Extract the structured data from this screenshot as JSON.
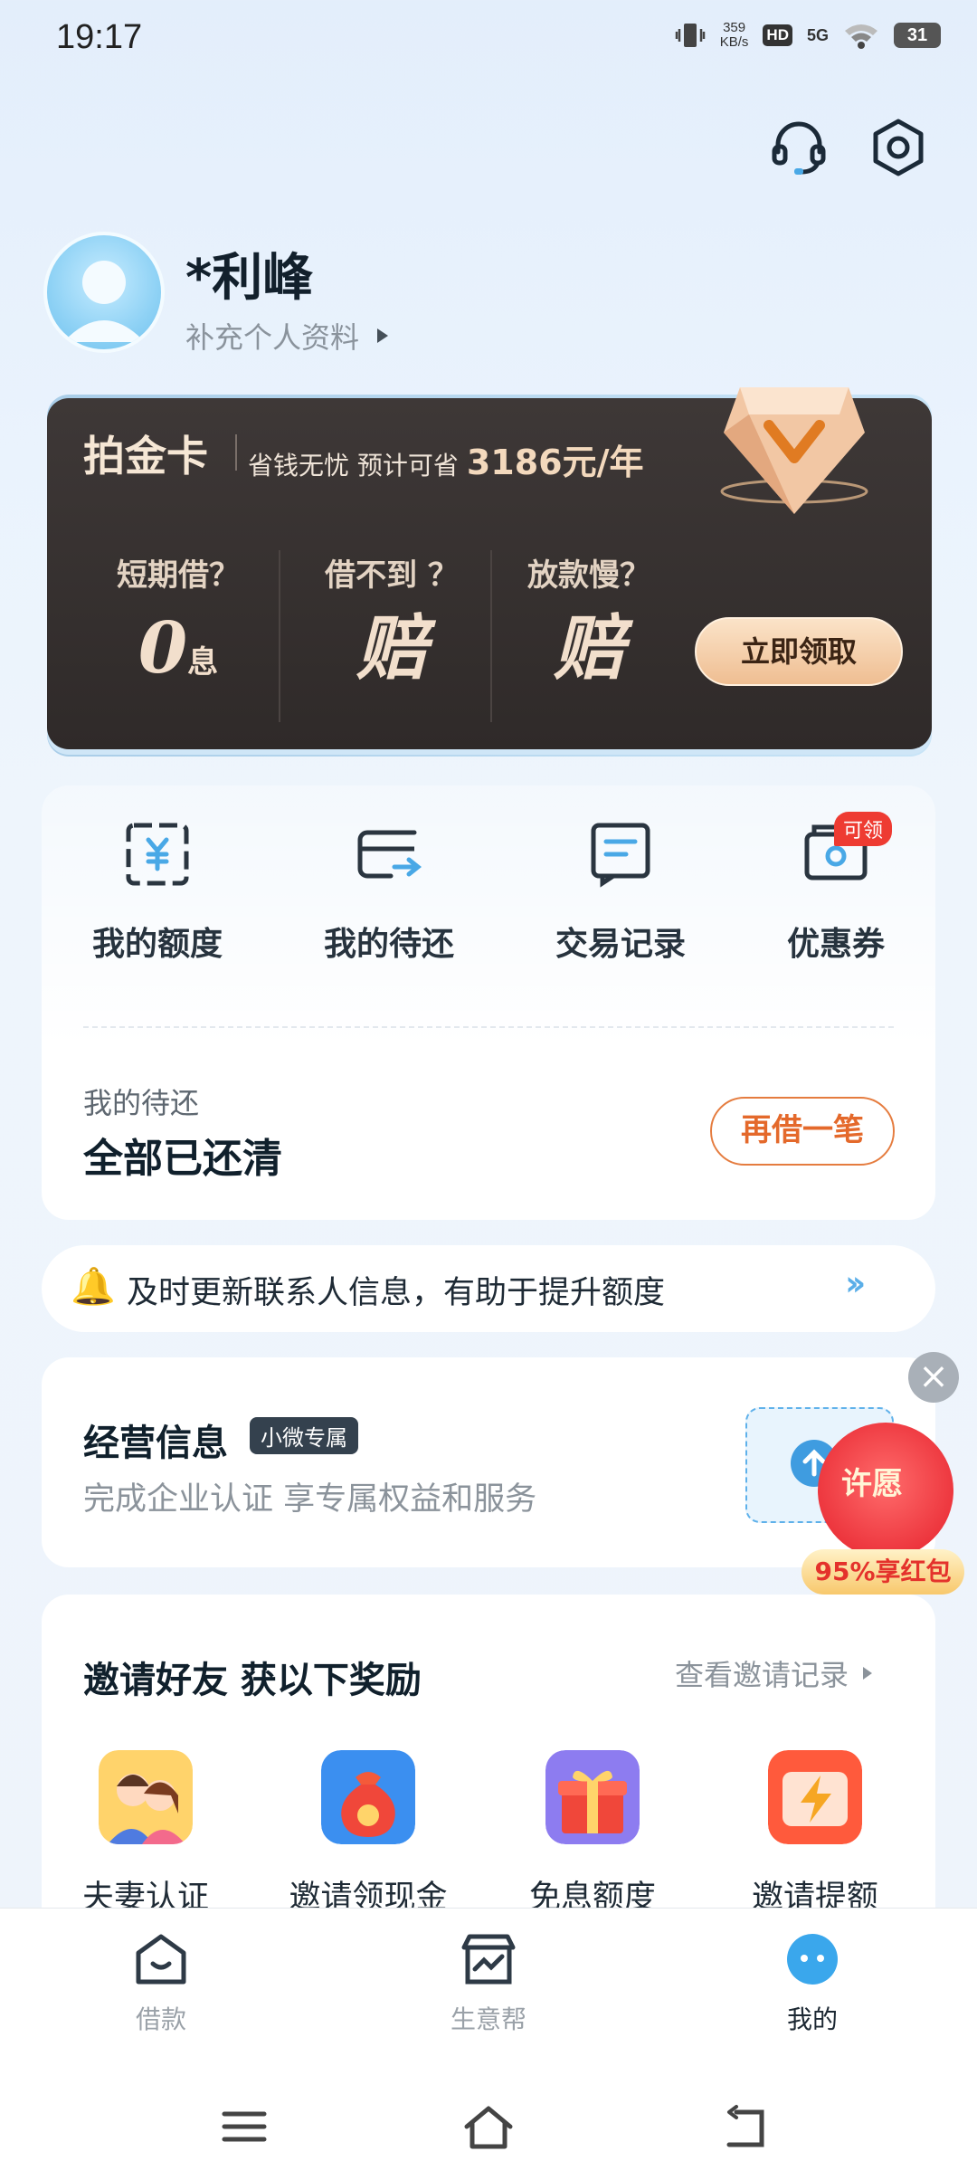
{
  "status_bar": {
    "time": "19:17",
    "speed_value": "359",
    "speed_unit": "KB/s",
    "hd": "HD",
    "network": "5G",
    "battery": "31"
  },
  "profile": {
    "name": "*利峰",
    "complete_link": "补充个人资料"
  },
  "platinum_card": {
    "title": "拍金卡",
    "subtitle": "省钱无忧 预计可省",
    "savings": "3186元/年",
    "columns": [
      {
        "question": "短期借？",
        "value": "0",
        "unit": "息"
      },
      {
        "question": "借不到 ？",
        "value": "赔",
        "unit": ""
      },
      {
        "question": "放款慢？",
        "value": "赔",
        "unit": ""
      }
    ],
    "claim_button": "立即领取"
  },
  "quick_actions": [
    {
      "label": "我的额度",
      "icon": "yuan-wallet-icon"
    },
    {
      "label": "我的待还",
      "icon": "repay-card-icon"
    },
    {
      "label": "交易记录",
      "icon": "record-icon"
    },
    {
      "label": "优惠券",
      "icon": "coupon-icon",
      "badge": "可领"
    }
  ],
  "repayment": {
    "label": "我的待还",
    "status": "全部已还清",
    "button": "再借一笔"
  },
  "notice": {
    "text": "及时更新联系人信息，有助于提升额度",
    "icon": "bell-icon"
  },
  "business": {
    "title": "经营信息",
    "tag": "小微专属",
    "subtitle": "完成企业认证 享专属权益和服务"
  },
  "wish_float": {
    "label": "许愿",
    "pill": "95%享红包"
  },
  "invite": {
    "title": "邀请好友 获以下奖励",
    "link": "查看邀请记录",
    "rewards": [
      {
        "label": "夫妻认证",
        "icon": "couple-icon"
      },
      {
        "label": "邀请领现金",
        "icon": "money-bag-icon"
      },
      {
        "label": "免息额度",
        "icon": "gift-box-icon"
      },
      {
        "label": "邀请提额",
        "icon": "lightning-icon"
      }
    ]
  },
  "tab_bar": [
    {
      "label": "借款",
      "icon": "loan-icon"
    },
    {
      "label": "生意帮",
      "icon": "business-icon"
    },
    {
      "label": "我的",
      "icon": "me-icon",
      "active": true
    }
  ],
  "colors": {
    "accent_blue": "#49a8e6",
    "orange": "#e4692b",
    "card_dark": "#3a3433",
    "gold": "#f0c293"
  }
}
